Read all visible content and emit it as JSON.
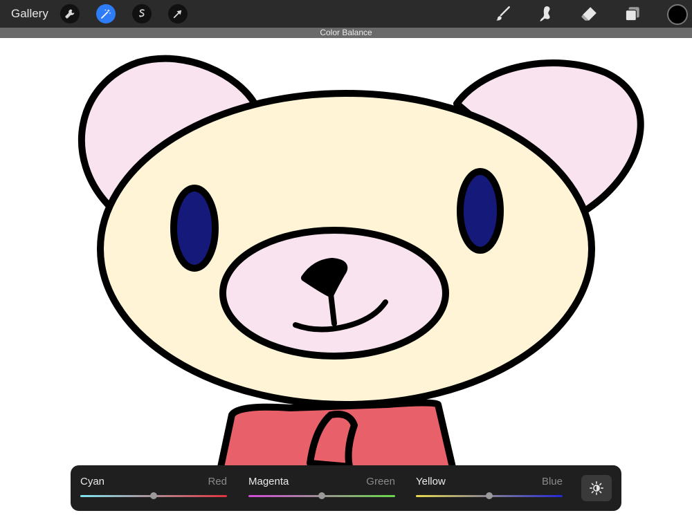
{
  "toolbar": {
    "gallery_label": "Gallery",
    "left_tools": [
      {
        "icon": "wrench-icon",
        "name": "actions"
      },
      {
        "icon": "magic-wand-icon",
        "name": "adjustments",
        "active": true
      },
      {
        "icon": "selection-icon",
        "name": "selection"
      },
      {
        "icon": "transform-arrow-icon",
        "name": "transform"
      }
    ],
    "right_tools": [
      {
        "icon": "brush-icon",
        "name": "paint"
      },
      {
        "icon": "smudge-icon",
        "name": "smudge"
      },
      {
        "icon": "eraser-icon",
        "name": "erase"
      },
      {
        "icon": "layers-icon",
        "name": "layers"
      }
    ],
    "current_color": "#000000"
  },
  "adjustment": {
    "title": "Color Balance"
  },
  "color_balance": {
    "sliders": [
      {
        "left": "Cyan",
        "right": "Red",
        "value": 0.5,
        "gradient": [
          "#7ee6f0",
          "#e0333c"
        ]
      },
      {
        "left": "Magenta",
        "right": "Green",
        "value": 0.5,
        "gradient": [
          "#d04bd8",
          "#68d84a"
        ]
      },
      {
        "left": "Yellow",
        "right": "Blue",
        "value": 0.5,
        "gradient": [
          "#e9d94e",
          "#2228d6"
        ]
      }
    ],
    "mode_button_icon": "brightness-sun-icon"
  },
  "artwork": {
    "subject": "teddy bear",
    "colors": {
      "head": "#fff5d6",
      "ears": "#f9e3ef",
      "eyes": "#15197a",
      "snout": "#f9e3ef",
      "body": "#e8606a",
      "outline": "#000000"
    }
  }
}
